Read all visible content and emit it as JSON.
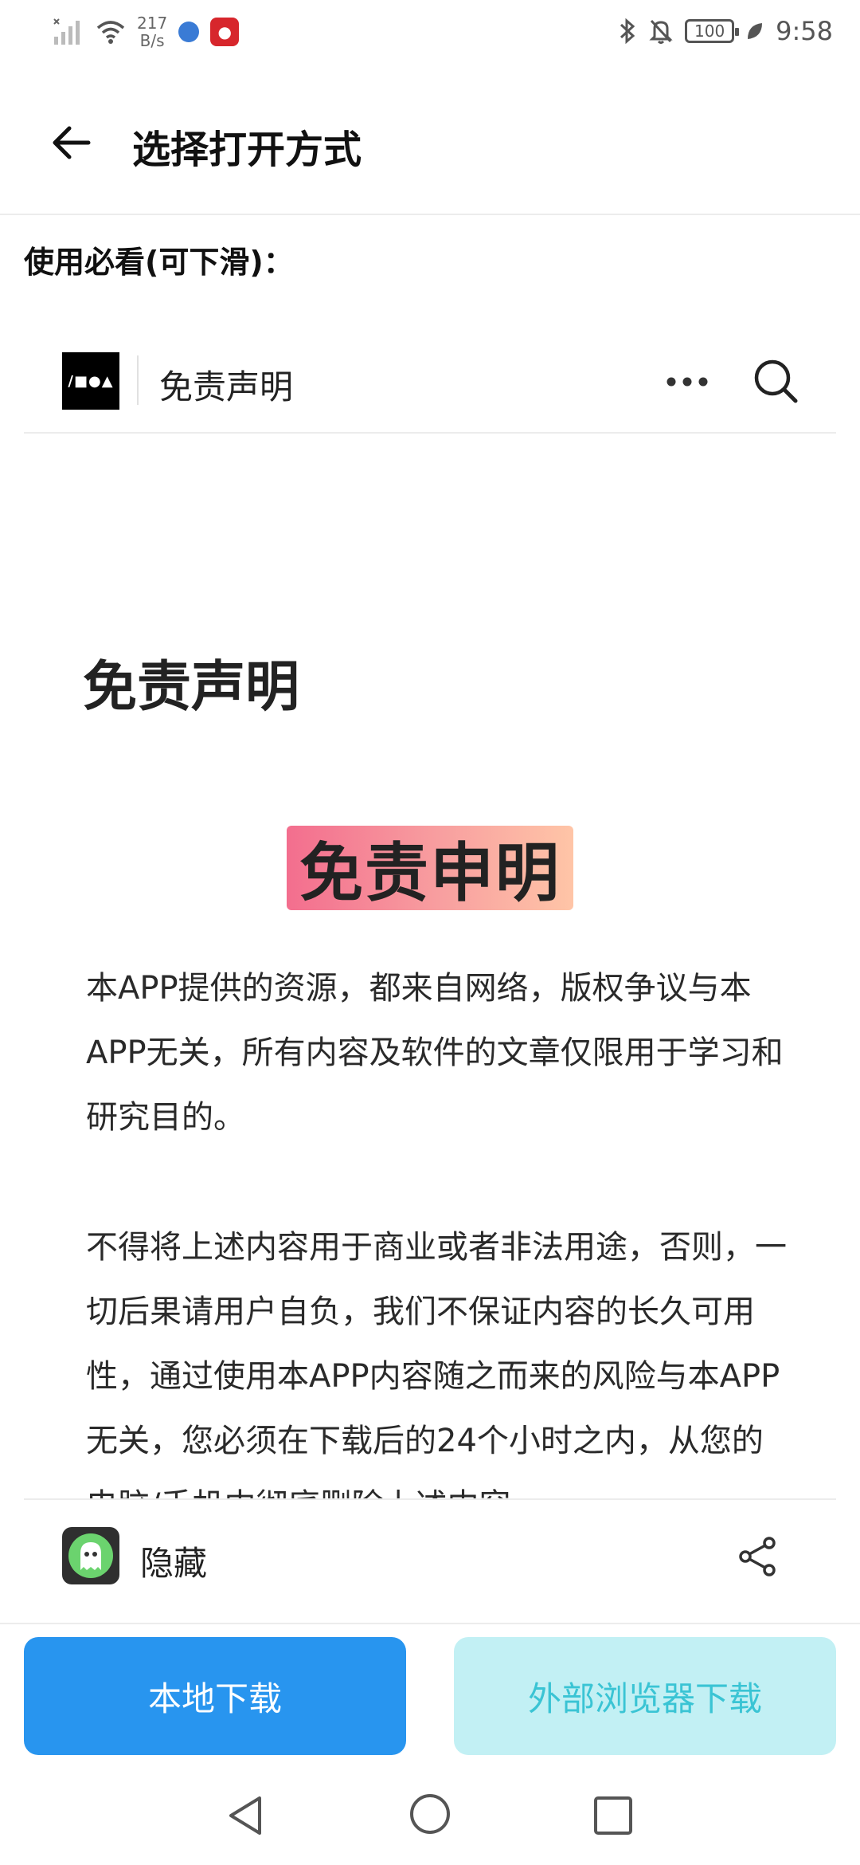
{
  "status_bar": {
    "net_speed_value": "217",
    "net_speed_unit": "B/s",
    "battery": "100",
    "time": "9:58"
  },
  "app_bar": {
    "title": "选择打开方式"
  },
  "notice_label": "使用必看(可下滑)：",
  "article": {
    "logo_text": "/■●▲",
    "site_title": "免责声明",
    "heading": "免责声明",
    "banner_text": "免责申明",
    "paragraphs": [
      "本APP提供的资源，都来自网络，版权争议与本APP无关，所有内容及软件的文章仅限用于学习和研究目的。",
      "不得将上述内容用于商业或者非法用途，否则，一切后果请用户自负，我们不保证内容的长久可用性，通过使用本APP内容随之而来的风险与本APP无关，您必须在下载后的24个小时之内，从您的电脑/手机中彻底删除上述内容。"
    ]
  },
  "hide_row": {
    "label": "隐藏"
  },
  "buttons": {
    "local_download": "本地下载",
    "external_download": "外部浏览器下载"
  },
  "colors": {
    "primary_button": "#2895ef",
    "secondary_button_bg": "#c2f0f4",
    "secondary_button_text": "#3ac4d4",
    "ghost_green": "#6bd36e"
  }
}
